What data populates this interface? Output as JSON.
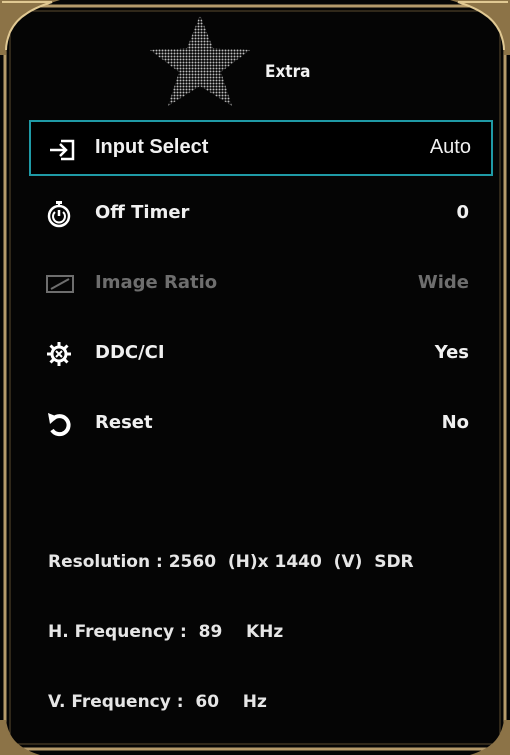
{
  "header": {
    "title": "Extra",
    "icon": "star-icon"
  },
  "menu": {
    "items": [
      {
        "label": "Input Select",
        "value": "Auto",
        "icon": "input-arrow-icon",
        "selected": true
      },
      {
        "label": "Off Timer",
        "value": "0",
        "icon": "stopwatch-icon"
      },
      {
        "label": "Image Ratio",
        "value": "Wide",
        "icon": "aspect-ratio-icon",
        "disabled": true
      },
      {
        "label": "DDC/CI",
        "value": "Yes",
        "icon": "ddc-gear-icon"
      },
      {
        "label": "Reset",
        "value": "No",
        "icon": "reset-icon"
      }
    ]
  },
  "info": {
    "resolution": "Resolution : 2560  (H)x 1440  (V)  SDR",
    "h_frequency": "H. Frequency :  89    KHz",
    "v_frequency": "V. Frequency :  60    Hz"
  },
  "colors": {
    "accent": "#1f9aa6",
    "frame": "#b59a6a",
    "text": "#f0f0f0",
    "disabled": "#6e6e6e"
  }
}
